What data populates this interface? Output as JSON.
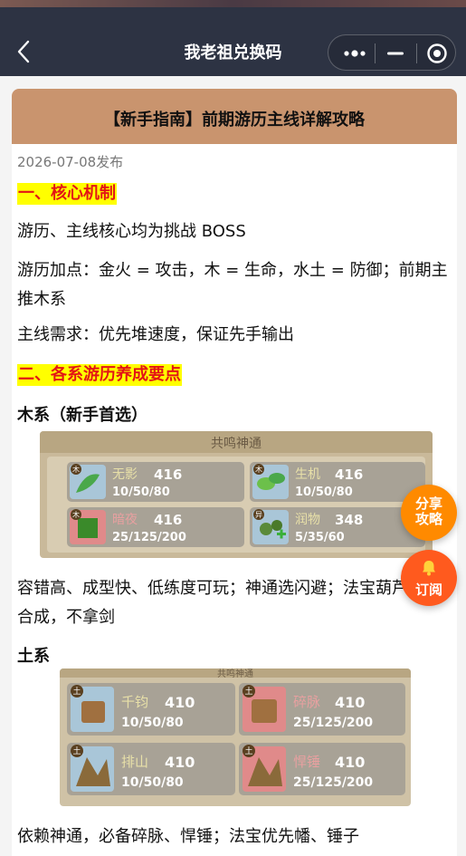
{
  "nav": {
    "title": "我老祖兑换码",
    "back_icon": "chevron-left-icon",
    "more_icon": "more-dots-icon",
    "minimize_icon": "minimize-icon",
    "close_icon": "target-close-icon"
  },
  "article": {
    "title": "【新手指南】前期游历主线详解攻略",
    "date": "2026-07-08发布",
    "section1": "一、核心机制",
    "p1": "游历、主线核心均为挑战 BOSS",
    "p2": "游历加点：金火 = 攻击，木 = 生命，水土 = 防御；前期主推木系",
    "p3": "主线需求：优先堆速度，保证先手输出",
    "section2": "二、各系游历养成要点",
    "wood_heading": "木系（新手首选）",
    "wood_text": "容错高、成型快、低练度可玩；神通选闪避；法宝葫芦子不合成，不拿剑",
    "earth_heading": "土系",
    "earth_text": "依赖神通，必备碎脉、悍锤；法宝优先幡、锤子"
  },
  "wood_image": {
    "banner": "共鸣神通",
    "skills": [
      {
        "element": "木",
        "name": "无影",
        "level": "416",
        "progress": "10/50/80"
      },
      {
        "element": "木",
        "name": "生机",
        "level": "416",
        "progress": "10/50/80"
      },
      {
        "element": "木",
        "name": "暗夜",
        "level": "416",
        "progress": "25/125/200"
      },
      {
        "element": "异",
        "name": "润物",
        "level": "348",
        "progress": "5/35/60"
      }
    ]
  },
  "earth_image": {
    "banner": "共鸣神通",
    "skills": [
      {
        "element": "土",
        "name": "千钧",
        "level": "410",
        "progress": "10/50/80"
      },
      {
        "element": "土",
        "name": "碎脉",
        "level": "410",
        "progress": "25/125/200"
      },
      {
        "element": "土",
        "name": "排山",
        "level": "410",
        "progress": "10/50/80"
      },
      {
        "element": "土",
        "name": "悍锤",
        "level": "410",
        "progress": "25/125/200"
      }
    ]
  },
  "floating": {
    "share_line1": "分享",
    "share_line2": "攻略",
    "subscribe": "订阅",
    "bell_icon": "bell-icon"
  },
  "colors": {
    "nav_bg": "#2d3343",
    "header_bg": "#c9946e",
    "highlight_bg": "#ffff00",
    "highlight_text": "#e31515",
    "share_btn": "#ff8a00",
    "subscribe_btn": "#ff5a1e"
  }
}
